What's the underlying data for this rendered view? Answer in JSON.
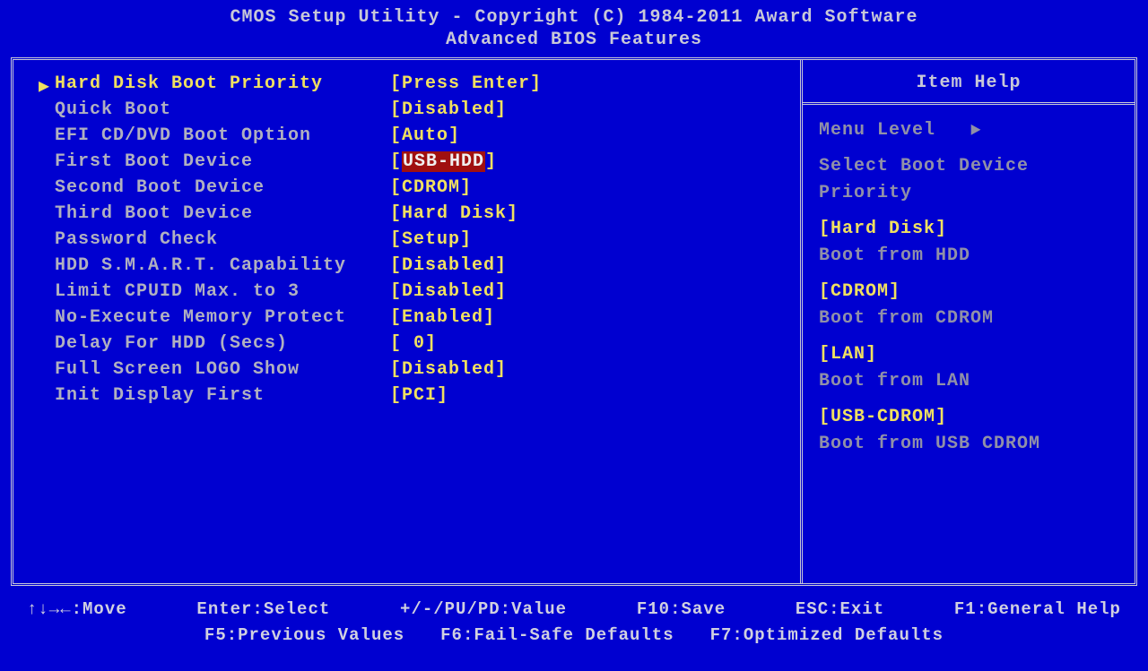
{
  "header": {
    "line1": "CMOS Setup Utility - Copyright (C) 1984-2011 Award Software",
    "line2": "Advanced BIOS Features"
  },
  "settings": [
    {
      "label": "Hard Disk Boot Priority",
      "value": "[Press Enter]",
      "selected": true,
      "highlight": false
    },
    {
      "label": "Quick Boot",
      "value": "[Disabled]",
      "selected": false,
      "highlight": false
    },
    {
      "label": "EFI CD/DVD Boot Option",
      "value": "[Auto]",
      "selected": false,
      "highlight": false
    },
    {
      "label": "First Boot Device",
      "value_prefix": "[",
      "value_hl": "USB-HDD",
      "value_suffix": "]",
      "selected": false,
      "highlight": true
    },
    {
      "label": "Second Boot Device",
      "value": "[CDROM]",
      "selected": false,
      "highlight": false
    },
    {
      "label": "Third Boot Device",
      "value": "[Hard Disk]",
      "selected": false,
      "highlight": false
    },
    {
      "label": "Password Check",
      "value": "[Setup]",
      "selected": false,
      "highlight": false
    },
    {
      "label": "HDD S.M.A.R.T. Capability",
      "value": "[Disabled]",
      "selected": false,
      "highlight": false
    },
    {
      "label": "Limit CPUID Max. to 3",
      "value": "[Disabled]",
      "selected": false,
      "highlight": false
    },
    {
      "label": "No-Execute Memory Protect",
      "value": "[Enabled]",
      "selected": false,
      "highlight": false
    },
    {
      "label": "Delay For HDD (Secs)",
      "value": "[ 0]",
      "selected": false,
      "highlight": false
    },
    {
      "label": "Full Screen LOGO Show",
      "value": "[Disabled]",
      "selected": false,
      "highlight": false
    },
    {
      "label": "Init Display First",
      "value": "[PCI]",
      "selected": false,
      "highlight": false
    }
  ],
  "help": {
    "title": "Item Help",
    "menu_level_label": "Menu Level",
    "menu_level_arrow": "▶",
    "desc1": "Select Boot Device",
    "desc2": "Priority",
    "items": [
      {
        "name": "[Hard Disk]",
        "desc": "Boot from HDD"
      },
      {
        "name": "[CDROM]",
        "desc": "Boot from CDROM"
      },
      {
        "name": "[LAN]",
        "desc": "Boot from LAN"
      },
      {
        "name": "[USB-CDROM]",
        "desc": "Boot from USB CDROM"
      }
    ]
  },
  "footer": {
    "row1": [
      "↑↓→←:Move",
      "Enter:Select",
      "+/-/PU/PD:Value",
      "F10:Save",
      "ESC:Exit",
      "F1:General Help"
    ],
    "row2": [
      "F5:Previous Values",
      "F6:Fail-Safe Defaults",
      "F7:Optimized Defaults"
    ]
  }
}
